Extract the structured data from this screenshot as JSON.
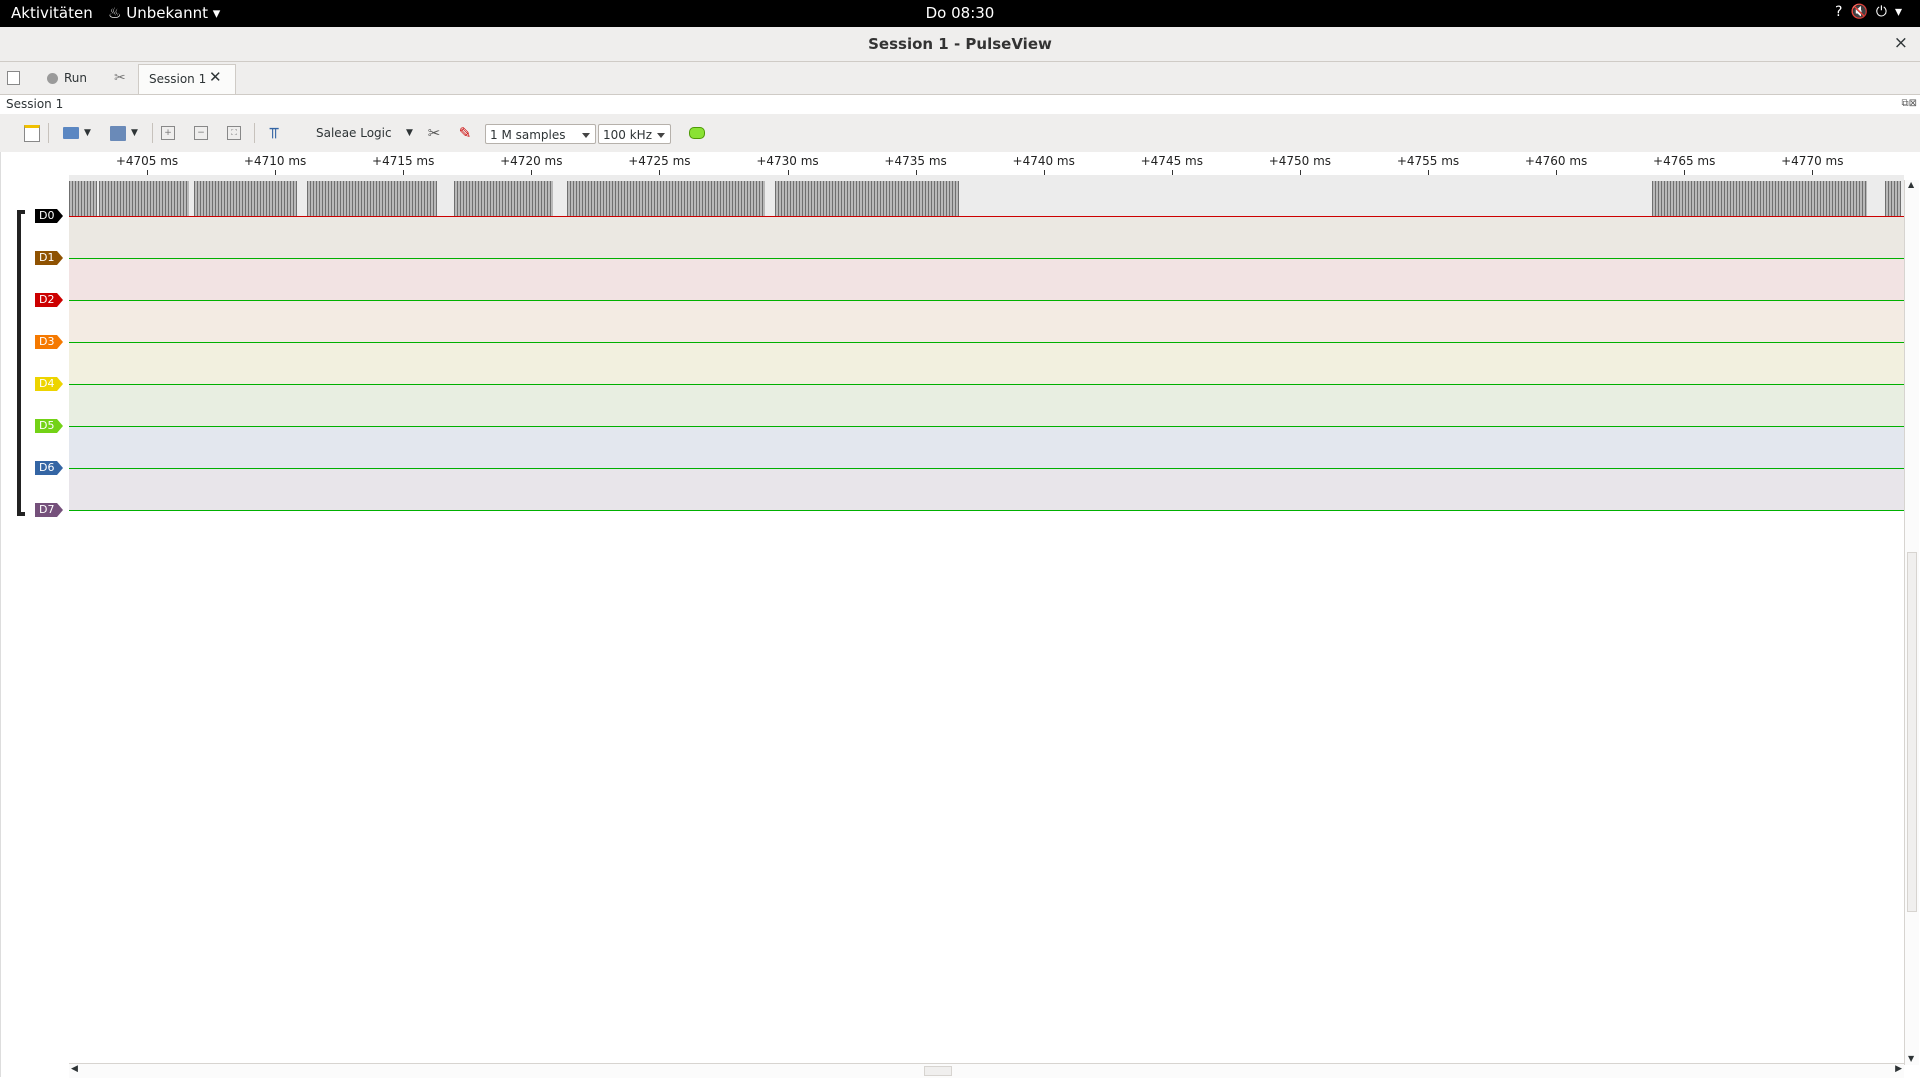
{
  "topbar": {
    "activities": "Aktivitäten",
    "app_menu": "Unbekannt",
    "clock": "Do 08:30"
  },
  "window": {
    "title": "Session 1 - PulseView",
    "close": "×"
  },
  "tabs": {
    "run_label": "Run",
    "session_label": "Session 1"
  },
  "session_label": "Session 1",
  "toolbar": {
    "device": "Saleae Logic",
    "samples": "1 M samples",
    "samplerate": "100 kHz"
  },
  "ruler": {
    "ticks": [
      "+4705 ms",
      "+4710 ms",
      "+4715 ms",
      "+4720 ms",
      "+4725 ms",
      "+4730 ms",
      "+4735 ms",
      "+4740 ms",
      "+4745 ms",
      "+4750 ms",
      "+4755 ms",
      "+4760 ms",
      "+4765 ms",
      "+4770 ms"
    ]
  },
  "channels": [
    {
      "name": "D0",
      "color": "#000000",
      "bg": "#ececec",
      "line": "#cc0000"
    },
    {
      "name": "D1",
      "color": "#8f5202",
      "bg": "#ebe8e2",
      "line": "#00b000"
    },
    {
      "name": "D2",
      "color": "#cc0000",
      "bg": "#f2e3e3",
      "line": "#00b000"
    },
    {
      "name": "D3",
      "color": "#f57900",
      "bg": "#f3ebe3",
      "line": "#00b000"
    },
    {
      "name": "D4",
      "color": "#edd400",
      "bg": "#f2f0df",
      "line": "#00b000"
    },
    {
      "name": "D5",
      "color": "#73d216",
      "bg": "#e8eee1",
      "line": "#00b000"
    },
    {
      "name": "D6",
      "color": "#3465a4",
      "bg": "#e3e7ee",
      "line": "#00b000"
    },
    {
      "name": "D7",
      "color": "#75507b",
      "bg": "#e8e5ea",
      "line": "#00b000"
    }
  ]
}
